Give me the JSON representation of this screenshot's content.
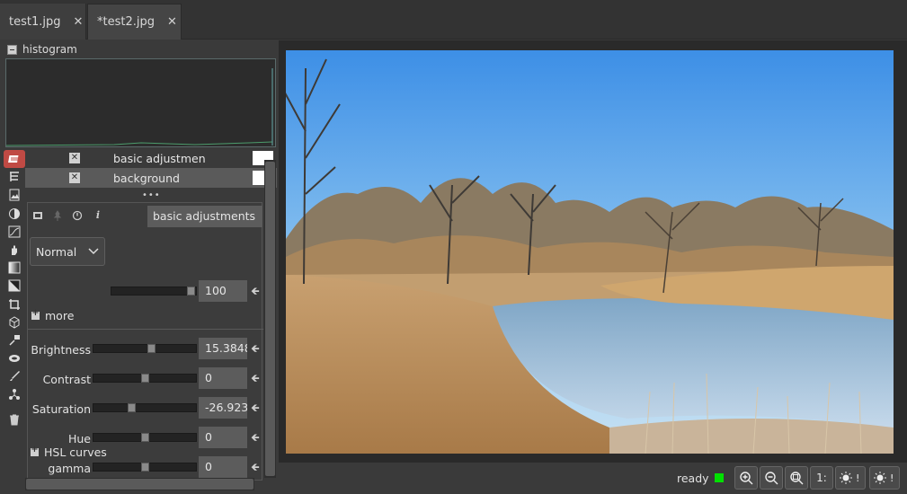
{
  "tabs": [
    {
      "label": "test1.jpg",
      "close": "✕"
    },
    {
      "label": "*test2.jpg",
      "close": "✕"
    }
  ],
  "histogram": {
    "title": "histogram"
  },
  "layers": [
    {
      "name": "basic adjustmen",
      "visible": true
    },
    {
      "name": "background",
      "visible": true
    }
  ],
  "adjustment": {
    "title": "basic adjustments",
    "blend_mode": "Normal",
    "opacity": "100",
    "opacity_level": 1.0,
    "more_label": "more",
    "params": [
      {
        "label": "Brightness",
        "value": "15.3848"
      },
      {
        "label": "Contrast",
        "value": "0"
      },
      {
        "label": "Saturation",
        "value": "-26.923"
      },
      {
        "label": "Hue",
        "value": "0"
      },
      {
        "label": "gamma",
        "value": "0"
      }
    ],
    "curves_label": "HSL curves"
  },
  "status": {
    "text": "ready",
    "indicator_color": "#00e000",
    "zoom_label": "1:",
    "buttons": [
      "zoom-in-icon",
      "zoom-out-icon",
      "zoom-fit-icon",
      "zoom-1to1",
      "brightness-icon",
      "brightness-icon"
    ]
  },
  "colors": {
    "accent": "#c04a44",
    "sky": "#5aa8e8"
  }
}
